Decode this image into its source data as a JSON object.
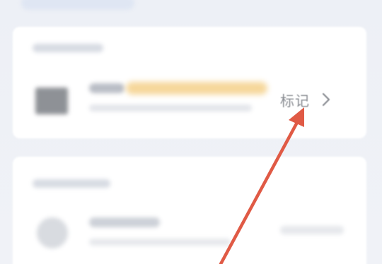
{
  "item": {
    "action_label": "标记"
  },
  "colors": {
    "background": "#eef1f7",
    "card": "#ffffff",
    "highlight": "#f6d79a",
    "annotation_arrow": "#e05a45",
    "action_text": "#8a8d93"
  },
  "icons": [
    "chevron-right-icon",
    "red-arrow-annotation"
  ]
}
